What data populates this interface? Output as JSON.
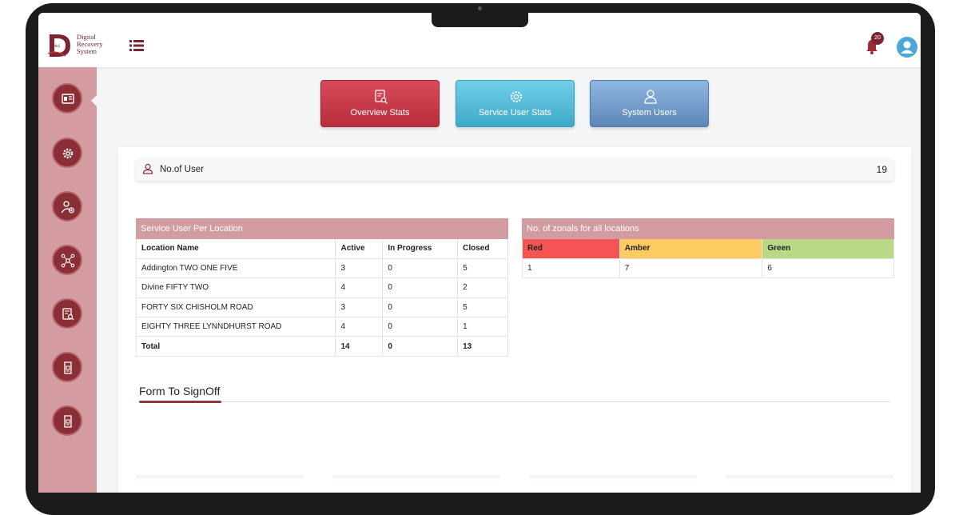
{
  "brand": {
    "logo_mark": "D&S",
    "name_lines": [
      "Digital",
      "Recovery",
      "System"
    ]
  },
  "header": {
    "notification_count": "20",
    "icons": {
      "menu": "list-icon",
      "notifications": "bell-icon",
      "profile": "user-avatar-icon"
    }
  },
  "sidebar": {
    "items": [
      {
        "icon": "dashboard-icon"
      },
      {
        "icon": "gear-icon"
      },
      {
        "icon": "user-add-icon"
      },
      {
        "icon": "network-icon"
      },
      {
        "icon": "report-search-icon"
      },
      {
        "icon": "document-icon"
      },
      {
        "icon": "document-icon"
      }
    ]
  },
  "stat_buttons": {
    "overview": "Overview Stats",
    "service_user": "Service User Stats",
    "system_users": "System Users"
  },
  "users_summary": {
    "label": "No.of User",
    "count": "19"
  },
  "location_table": {
    "title": "Service User Per Location",
    "headers": [
      "Location Name",
      "Active",
      "In Progress",
      "Closed"
    ],
    "rows": [
      [
        "Addington TWO ONE FIVE",
        "3",
        "0",
        "5"
      ],
      [
        "Divine FIFTY TWO",
        "4",
        "0",
        "2"
      ],
      [
        "FORTY SIX CHISHOLM ROAD",
        "3",
        "0",
        "5"
      ],
      [
        "EIGHTY THREE LYNNDHURST ROAD",
        "4",
        "0",
        "1"
      ]
    ],
    "total": [
      "Total",
      "14",
      "0",
      "13"
    ]
  },
  "zonal_table": {
    "title": "No. of zonals for all locations",
    "headers": [
      "Red",
      "Amber",
      "Green"
    ],
    "header_colors": [
      "#f65353",
      "#fecb62",
      "#b9d986"
    ],
    "values": [
      "1",
      "7",
      "6"
    ]
  },
  "signoff": {
    "title": "Form To SignOff"
  },
  "colors": {
    "brand": "#8b2f37",
    "sidebar": "#d29ca0",
    "overview_btn": "#c93a4a",
    "service_btn": "#4db8d6",
    "users_btn": "#6e96c5"
  }
}
